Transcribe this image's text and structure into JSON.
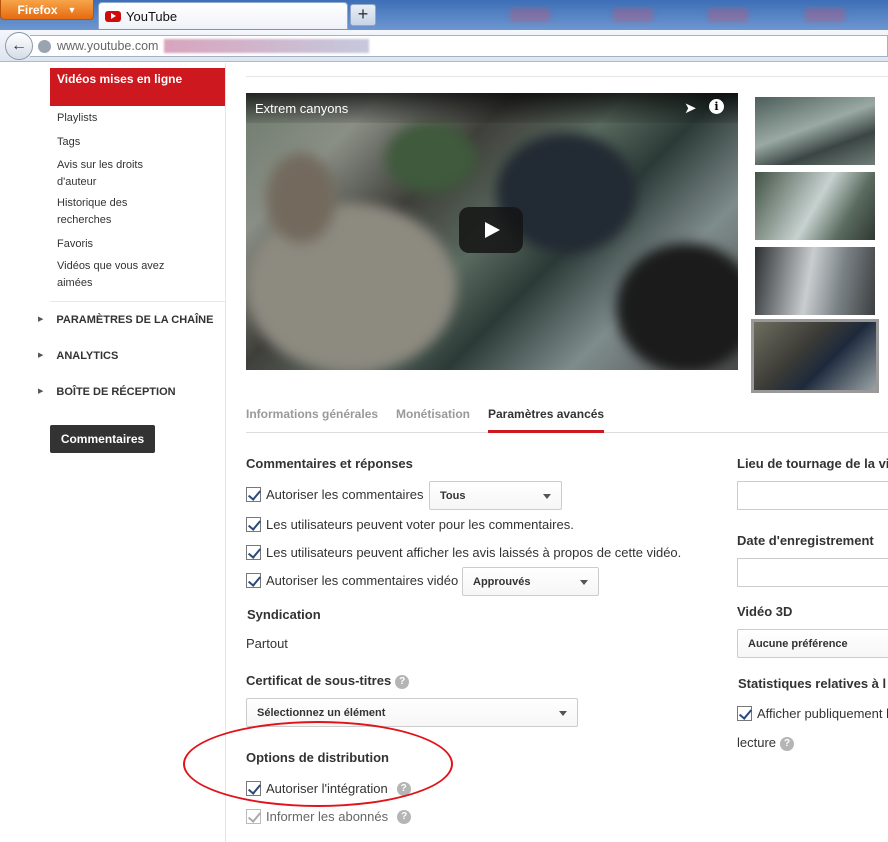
{
  "browser": {
    "firefox_label": "Firefox",
    "tab_title": "YouTube",
    "new_tab_symbol": "+",
    "url": "www.youtube.com"
  },
  "sidebar": {
    "active_item": "Vidéos mises en ligne",
    "items": [
      "Playlists",
      "Tags",
      "Avis sur les droits d'auteur",
      "Historique des recherches",
      "Favoris",
      "Vidéos que vous avez aimées"
    ],
    "sections": [
      "PARAMÈTRES DE LA CHAÎNE",
      "ANALYTICS",
      "BOÎTE DE RÉCEPTION"
    ],
    "comments_button": "Commentaires"
  },
  "video": {
    "title": "Extrem canyons"
  },
  "tabs": [
    {
      "label": "Informations générales",
      "active": false
    },
    {
      "label": "Monétisation",
      "active": false
    },
    {
      "label": "Paramètres avancés",
      "active": true
    }
  ],
  "comments": {
    "heading": "Commentaires et réponses",
    "allow_comments": "Autoriser les commentaires",
    "allow_comments_value": "Tous",
    "vote": "Les utilisateurs peuvent voter pour les commentaires.",
    "view_ratings": "Les utilisateurs peuvent afficher les avis laissés à propos de cette vidéo.",
    "video_comments": "Autoriser les commentaires vidéo",
    "video_comments_value": "Approuvés"
  },
  "syndication": {
    "heading": "Syndication",
    "value": "Partout"
  },
  "captions": {
    "heading": "Certificat de sous-titres",
    "select": "Sélectionnez un élément"
  },
  "distribution": {
    "heading": "Options de distribution",
    "embed": "Autoriser l'intégration",
    "notify": "Informer les abonnés"
  },
  "right": {
    "location_heading": "Lieu de tournage de la vi",
    "date_heading": "Date d'enregistrement",
    "video3d_heading": "Vidéo 3D",
    "video3d_value": "Aucune préférence",
    "stats_heading": "Statistiques relatives à l",
    "stats_checkbox": "Afficher publiquement l",
    "stats_cont": "lecture"
  },
  "colors": {
    "accent_red": "#cc181e",
    "annotation_red": "#e0131b"
  }
}
